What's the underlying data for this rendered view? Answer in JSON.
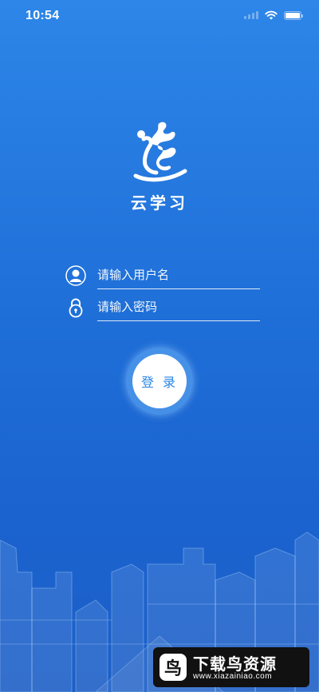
{
  "status_bar": {
    "time": "10:54"
  },
  "app": {
    "name": "云学习"
  },
  "login_form": {
    "username_placeholder": "请输入用户名",
    "password_placeholder": "请输入密码",
    "login_label": "登 录"
  },
  "watermark": {
    "title": "下载鸟资源",
    "url": "www.xiazainiao.com",
    "icon_char": "鸟"
  },
  "colors": {
    "background": "#2377e0",
    "button_text": "#2b86e4",
    "button_ring": "#78beff"
  }
}
